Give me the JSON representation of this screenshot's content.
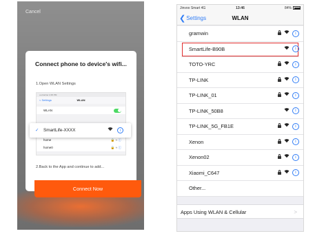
{
  "left": {
    "cancel": "Cancel",
    "title": "Connect phone to device's wifi...",
    "step1": "1.Open WLAN Settings",
    "step2": "2.Back to the App and continue to add...",
    "button": "Connect Now",
    "mini": {
      "status": "••••Carrier  2:45 PM",
      "back": "< Settings",
      "title": "WLAN",
      "wlan_row": "WLAN",
      "section": "CHOOSE A NETWORK...",
      "networks": [
        "home",
        "home0"
      ]
    },
    "popout": {
      "check": "✓",
      "network": "SmartLife-XXXX",
      "info": "i"
    }
  },
  "right": {
    "status": {
      "carrier": "Jinvoo Smart  4G",
      "time": "13:46",
      "battery": "84%"
    },
    "nav": {
      "back": "Settings",
      "title": "WLAN"
    },
    "networks": [
      {
        "name": "gramwin",
        "locked": true,
        "highlight": false
      },
      {
        "name": "SmartLife-B90B",
        "locked": false,
        "highlight": true
      },
      {
        "name": "TOTO-YRC",
        "locked": true,
        "highlight": false
      },
      {
        "name": "TP-LINK",
        "locked": true,
        "highlight": false
      },
      {
        "name": "TP-LINK_01",
        "locked": true,
        "highlight": false
      },
      {
        "name": "TP-LINK_50B8",
        "locked": false,
        "highlight": false
      },
      {
        "name": "TP-LINK_5G_FB1E",
        "locked": true,
        "highlight": false
      },
      {
        "name": "Xenon",
        "locked": true,
        "highlight": false
      },
      {
        "name": "Xenon02",
        "locked": true,
        "highlight": false
      },
      {
        "name": "Xiaomi_C647",
        "locked": true,
        "highlight": false
      },
      {
        "name": "Other...",
        "locked": false,
        "highlight": false,
        "other": true
      }
    ],
    "apps_row": "Apps Using WLAN & Cellular",
    "apps_chevron": ">"
  },
  "icons": {
    "wifi": "wifi-icon",
    "lock": "lock-icon",
    "info": "info-icon",
    "back": "chevron-left-icon"
  },
  "colors": {
    "accent": "#ff5a0d",
    "ios_blue": "#2f7cf6",
    "highlight_border": "#e02b2b"
  }
}
